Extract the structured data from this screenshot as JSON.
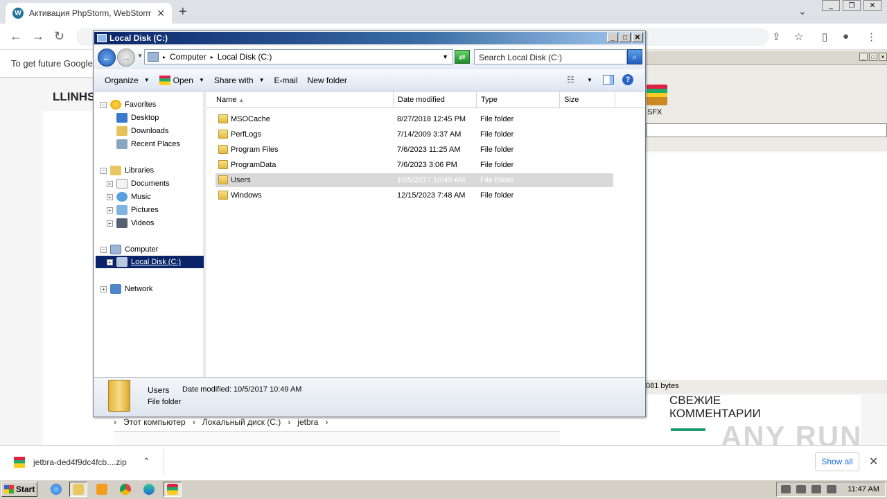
{
  "browser": {
    "tab_title": "Активация PhpStorm, WebStorm, I",
    "infobar_text": "To get future Google",
    "download_file": "jetbra-ded4f9dc4fcb....zip",
    "show_all": "Show all"
  },
  "webpage": {
    "site_title": "LLINHS",
    "comments_heading": "СВЕЖИЕ КОММЕНТАРИИ",
    "watermark": "ANY RUN"
  },
  "bg_explorer": {
    "path": [
      "Этот компьютер",
      "Локальный диск (C:)",
      "jetbra"
    ]
  },
  "bg_archiver": {
    "sfx_label": "SFX",
    "status_bytes": "081 bytes"
  },
  "explorer": {
    "title": "Local Disk (C:)",
    "address": [
      "Computer",
      "Local Disk (C:)"
    ],
    "search_placeholder": "Search Local Disk (C:)",
    "commands": {
      "organize": "Organize",
      "open": "Open",
      "share_with": "Share with",
      "email": "E-mail",
      "new_folder": "New folder"
    },
    "nav": {
      "favorites": "Favorites",
      "desktop": "Desktop",
      "downloads": "Downloads",
      "recent_places": "Recent Places",
      "libraries": "Libraries",
      "documents": "Documents",
      "music": "Music",
      "pictures": "Pictures",
      "videos": "Videos",
      "computer": "Computer",
      "local_disk": "Local Disk (C:)",
      "network": "Network"
    },
    "columns": {
      "name": "Name",
      "date": "Date modified",
      "type": "Type",
      "size": "Size"
    },
    "files": [
      {
        "name": "MSOCache",
        "date": "8/27/2018 12:45 PM",
        "type": "File folder"
      },
      {
        "name": "PerfLogs",
        "date": "7/14/2009 3:37 AM",
        "type": "File folder"
      },
      {
        "name": "Program Files",
        "date": "7/6/2023 11:25 AM",
        "type": "File folder"
      },
      {
        "name": "ProgramData",
        "date": "7/6/2023 3:06 PM",
        "type": "File folder"
      },
      {
        "name": "Users",
        "date": "10/5/2017 10:49 AM",
        "type": "File folder"
      },
      {
        "name": "Windows",
        "date": "12/15/2023 7:48 AM",
        "type": "File folder"
      }
    ],
    "details": {
      "name": "Users",
      "date_label": "Date modified:",
      "date": "10/5/2017 10:49 AM",
      "type": "File folder"
    }
  },
  "taskbar": {
    "start": "Start",
    "clock": "11:47 AM"
  }
}
